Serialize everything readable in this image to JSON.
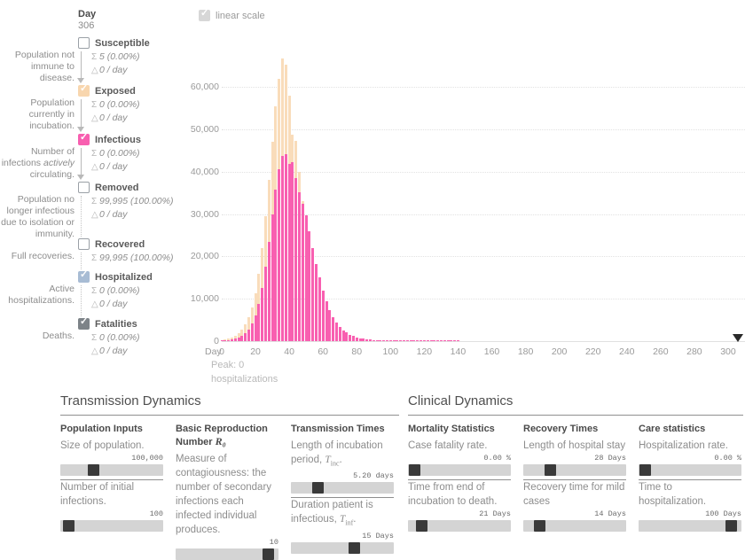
{
  "day": {
    "label": "Day",
    "value": "306"
  },
  "compartments": [
    {
      "name": "Susceptible",
      "checked": false,
      "color_class": "",
      "description": "Population not immune to disease.",
      "total": "5 (0.00%)",
      "rate": "0 / day",
      "connector": "solid"
    },
    {
      "name": "Exposed",
      "checked": true,
      "color_class": "c-exposed",
      "description": "Population currently in incubation.",
      "total": "0 (0.00%)",
      "rate": "0 / day",
      "connector": "solid"
    },
    {
      "name": "Infectious",
      "checked": true,
      "color_class": "c-infectious",
      "description_html": "Number of infections <i>actively</i> circulating.",
      "total": "0 (0.00%)",
      "rate": "0 / day",
      "connector": "solid"
    },
    {
      "name": "Removed",
      "checked": false,
      "color_class": "",
      "description": "Population no longer infectious due to isolation or immunity.",
      "total": "99,995 (100.00%)",
      "rate": "0 / day",
      "connector": "dotted"
    },
    {
      "name": "Recovered",
      "checked": false,
      "color_class": "",
      "description": "Full recoveries.",
      "total": "99,995 (100.00%)",
      "rate": "",
      "connector": "dotted"
    },
    {
      "name": "Hospitalized",
      "checked": true,
      "color_class": "c-hospitalized",
      "description": "Active hospitalizations.",
      "total": "0 (0.00%)",
      "rate": "0 / day",
      "connector": "dotted"
    },
    {
      "name": "Fatalities",
      "checked": true,
      "color_class": "c-fatalities",
      "description": "Deaths.",
      "total": "0 (0.00%)",
      "rate": "0 / day",
      "connector": "dotted"
    }
  ],
  "symbols": {
    "sum": "Σ",
    "delta": "△"
  },
  "chart_controls": {
    "scale_label": "linear scale",
    "scale_checked": true
  },
  "chart_note": {
    "line1": "Peak: 0",
    "line2": "hospitalizations"
  },
  "colors": {
    "exposed": "#f9dcba",
    "infectious": "#f85fb0",
    "hospitalized": "#a8bcd4",
    "fatalities": "#7d8388",
    "grid": "#e2e2e2",
    "axis_text": "#9a9a9a"
  },
  "chart_data": {
    "type": "bar",
    "title": "",
    "xlabel": "Day",
    "ylabel": "",
    "xlim": [
      0,
      310
    ],
    "ylim": [
      0,
      68000
    ],
    "grid": true,
    "legend_position": "left-panel",
    "stacking": "overlay",
    "xticks": [
      0,
      20,
      40,
      60,
      80,
      100,
      120,
      140,
      160,
      180,
      200,
      220,
      240,
      260,
      280,
      300
    ],
    "xtick_labels": [
      "0",
      "20",
      "40",
      "60",
      "80",
      "100",
      "120",
      "140",
      "160",
      "180",
      "200",
      "220",
      "240",
      "260",
      "280",
      "300"
    ],
    "yticks": [
      0,
      10000,
      20000,
      30000,
      40000,
      50000,
      60000
    ],
    "ytick_labels": [
      "0",
      "10,000",
      "20,000",
      "30,000",
      "40,000",
      "50,000",
      "60,000"
    ],
    "day_marker": 306,
    "series": [
      {
        "name": "Exposed",
        "color": "#f9dcba",
        "x": [
          0,
          2,
          4,
          6,
          8,
          10,
          12,
          14,
          16,
          18,
          20,
          22,
          24,
          26,
          28,
          30,
          32,
          34,
          36,
          38,
          40,
          42,
          44,
          46,
          48,
          50,
          52,
          54,
          56,
          58,
          60,
          62,
          64,
          66,
          68,
          70,
          72,
          74,
          76,
          78,
          80,
          82,
          84,
          86,
          88,
          90,
          92,
          94,
          96,
          98,
          100,
          102,
          104,
          106,
          108,
          110,
          112,
          114,
          116,
          118,
          120,
          122,
          124,
          126,
          128,
          130,
          132,
          134,
          136,
          138,
          140
        ],
        "values": [
          300,
          420,
          620,
          900,
          1300,
          1900,
          2700,
          3900,
          5600,
          8000,
          11400,
          16000,
          22000,
          29500,
          38000,
          47000,
          55500,
          62000,
          66800,
          65200,
          58000,
          48800,
          47200,
          40000,
          33000,
          27000,
          21500,
          16500,
          12500,
          9500,
          7000,
          5200,
          3800,
          2800,
          2000,
          1500,
          1100,
          800,
          600,
          430,
          320,
          240,
          180,
          130,
          100,
          75,
          55,
          40,
          30,
          22,
          16,
          12,
          9,
          7,
          5,
          4,
          3,
          2,
          2,
          1,
          1,
          1,
          1,
          0,
          0,
          0,
          0,
          0,
          0,
          0,
          0
        ]
      },
      {
        "name": "Infectious",
        "color": "#f85fb0",
        "x": [
          0,
          2,
          4,
          6,
          8,
          10,
          12,
          14,
          16,
          18,
          20,
          22,
          24,
          26,
          28,
          30,
          32,
          34,
          36,
          38,
          40,
          42,
          44,
          46,
          48,
          50,
          52,
          54,
          56,
          58,
          60,
          62,
          64,
          66,
          68,
          70,
          72,
          74,
          76,
          78,
          80,
          82,
          84,
          86,
          88,
          90,
          92,
          94,
          96,
          98,
          100,
          102,
          104,
          106,
          108,
          110,
          112,
          114,
          116,
          118,
          120,
          122,
          124,
          126,
          128,
          130,
          132,
          134,
          136,
          138,
          140
        ],
        "values": [
          120,
          180,
          270,
          400,
          600,
          880,
          1300,
          1900,
          2800,
          4100,
          6000,
          8700,
          12500,
          17500,
          23500,
          30000,
          35800,
          40500,
          43800,
          44200,
          41800,
          42300,
          38500,
          35200,
          32500,
          29800,
          26000,
          22000,
          18200,
          15000,
          12000,
          9400,
          7300,
          5700,
          4400,
          3400,
          2600,
          2000,
          1550,
          1200,
          900,
          700,
          540,
          420,
          330,
          260,
          200,
          160,
          125,
          100,
          80,
          64,
          50,
          40,
          32,
          26,
          20,
          16,
          13,
          10,
          8,
          6,
          5,
          4,
          3,
          2,
          2,
          1,
          1,
          1,
          1
        ]
      }
    ]
  },
  "transmission": {
    "heading": "Transmission Dynamics",
    "columns": [
      {
        "title": "Population Inputs",
        "params": [
          {
            "description": "Size of population.",
            "value": "100,000",
            "knob_pct": 30
          },
          {
            "description": "Number of initial infections.",
            "value": "100",
            "knob_pct": 3
          }
        ]
      },
      {
        "title": "Basic Reproduction Number",
        "title_math": "R₀",
        "params": [
          {
            "description": "Measure of contagiousness: the number of secondary infections each infected individual produces.",
            "value": "10",
            "knob_pct": 95
          }
        ]
      },
      {
        "title": "Transmission Times",
        "params": [
          {
            "description": "Length of incubation period,",
            "math": "T",
            "math_sub": "inc",
            "math_suffix": ".",
            "value": "5.20 days",
            "knob_pct": 23
          },
          {
            "description": "Duration patient is infectious,",
            "math": "T",
            "math_sub": "inf",
            "math_suffix": ".",
            "value": "15 Days",
            "knob_pct": 63
          }
        ]
      }
    ]
  },
  "clinical": {
    "heading": "Clinical Dynamics",
    "columns": [
      {
        "title": "Mortality Statistics",
        "params": [
          {
            "description": "Case fatality rate.",
            "value": "0.00 %",
            "knob_pct": 1
          },
          {
            "description": "Time from end of incubation to death.",
            "value": "21 Days",
            "knob_pct": 9
          }
        ]
      },
      {
        "title": "Recovery Times",
        "params": [
          {
            "description": "Length of hospital stay",
            "value": "28 Days",
            "knob_pct": 23
          },
          {
            "description": "Recovery time for mild cases",
            "value": "14 Days",
            "knob_pct": 12
          }
        ]
      },
      {
        "title": "Care statistics",
        "params": [
          {
            "description": "Hospitalization rate.",
            "value": "0.00 %",
            "knob_pct": 1
          },
          {
            "description": "Time to hospitalization.",
            "value": "100 Days",
            "knob_pct": 95
          }
        ]
      }
    ]
  }
}
